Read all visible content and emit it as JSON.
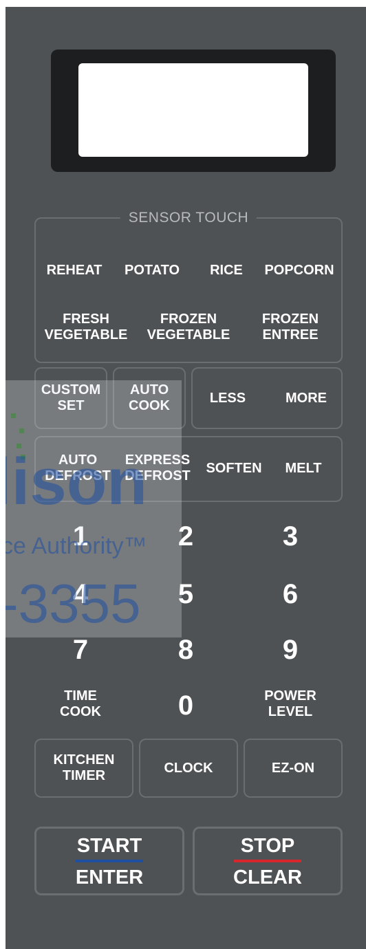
{
  "colors": {
    "panel": "#4f5254",
    "display_frame": "#1d1e20",
    "start_underline": "#1f4fa0",
    "stop_underline": "#d9262c"
  },
  "sensor_touch": {
    "title": "SENSOR TOUCH",
    "reheat": "REHEAT",
    "potato": "POTATO",
    "rice": "RICE",
    "popcorn": "POPCORN",
    "fresh_vegetable": "FRESH\nVEGETABLE",
    "frozen_vegetable": "FROZEN\nVEGETABLE",
    "frozen_entree": "FROZEN\nENTREE"
  },
  "row_custom": {
    "custom_set": "CUSTOM\nSET",
    "auto_cook": "AUTO\nCOOK",
    "less": "LESS",
    "more": "MORE"
  },
  "row_defrost": {
    "auto_defrost": "AUTO\nDEFROST",
    "express_defrost": "EXPRESS\nDEFROST",
    "soften": "SOFTEN",
    "melt": "MELT"
  },
  "keypad": {
    "n1": "1",
    "n2": "2",
    "n3": "3",
    "n4": "4",
    "n5": "5",
    "n6": "6",
    "n7": "7",
    "n8": "8",
    "n9": "9",
    "n0": "0",
    "time_cook": "TIME\nCOOK",
    "power_level": "POWER\nLEVEL"
  },
  "bottom_row": {
    "kitchen_timer": "KITCHEN\nTIMER",
    "clock": "CLOCK",
    "ez_on": "EZ-ON"
  },
  "start": {
    "top": "START",
    "bottom": "ENTER"
  },
  "stop": {
    "top": "STOP",
    "bottom": "CLEAR"
  },
  "watermark": {
    "line1": "lison",
    "line2": "ce Authority™",
    "line3": "-3355"
  }
}
